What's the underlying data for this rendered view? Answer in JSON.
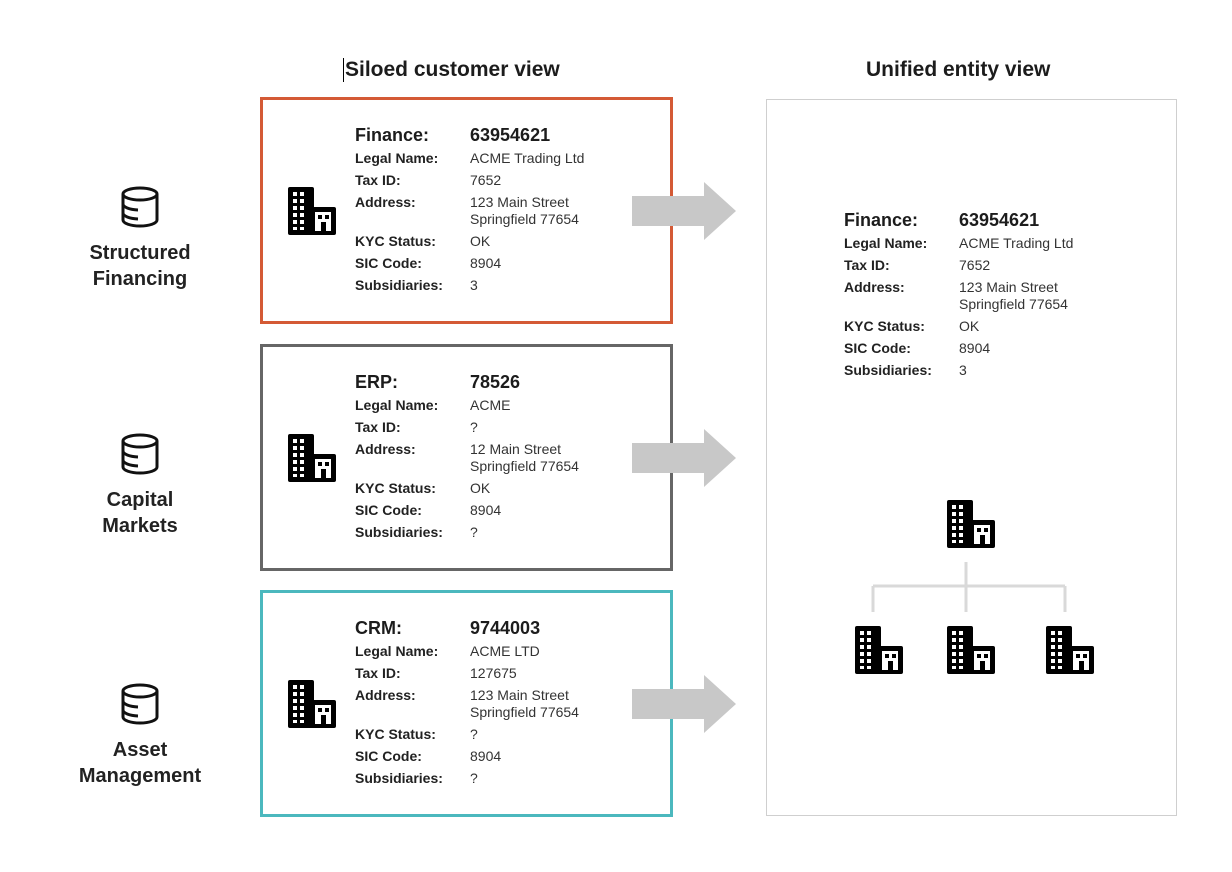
{
  "titles": {
    "siloed": "Siloed customer view",
    "unified": "Unified entity view"
  },
  "sources": [
    {
      "label_line1": "Structured",
      "label_line2": "Financing",
      "icon": "database-icon"
    },
    {
      "label_line1": "Capital",
      "label_line2": "Markets",
      "icon": "database-icon"
    },
    {
      "label_line1": "Asset",
      "label_line2": "Management",
      "icon": "database-icon"
    }
  ],
  "colors": {
    "finance_border": "#d45a35",
    "erp_border": "#666666",
    "crm_border": "#4bb8be",
    "arrow": "#c8c8c8",
    "tree_line": "#d9d9d9"
  },
  "field_labels": {
    "legal_name": "Legal Name:",
    "tax_id": "Tax ID:",
    "address": "Address:",
    "kyc_status": "KYC Status:",
    "sic_code": "SIC Code:",
    "subsidiaries": "Subsidiaries:"
  },
  "records": [
    {
      "system": "Finance:",
      "id": "63954621",
      "legal_name": "ACME Trading Ltd",
      "tax_id": "7652",
      "address_line1": "123 Main Street",
      "address_line2": "Springfield 77654",
      "kyc_status": "OK",
      "sic_code": "8904",
      "subsidiaries": "3"
    },
    {
      "system": "ERP:",
      "id": "78526",
      "legal_name": "ACME",
      "tax_id": "?",
      "address_line1": "12 Main Street",
      "address_line2": "Springfield 77654",
      "kyc_status": "OK",
      "sic_code": "8904",
      "subsidiaries": "?"
    },
    {
      "system": "CRM:",
      "id": "9744003",
      "legal_name": "ACME LTD",
      "tax_id": "127675",
      "address_line1": "123 Main Street",
      "address_line2": "Springfield 77654",
      "kyc_status": "?",
      "sic_code": "8904",
      "subsidiaries": "?"
    }
  ],
  "unified": {
    "system": "Finance:",
    "id": "63954621",
    "legal_name": "ACME Trading Ltd",
    "tax_id": "7652",
    "address_line1": "123 Main Street",
    "address_line2": "Springfield 77654",
    "kyc_status": "OK",
    "sic_code": "8904",
    "subsidiaries": "3"
  }
}
